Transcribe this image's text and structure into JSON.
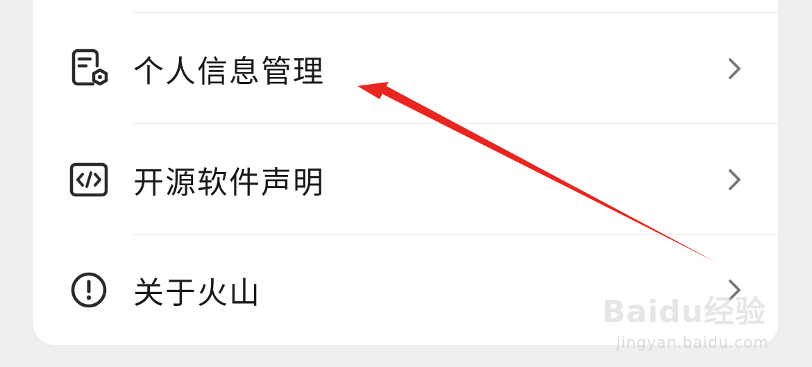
{
  "settings_list": {
    "items": [
      {
        "label": "个人信息管理",
        "icon": "document-settings-icon"
      },
      {
        "label": "开源软件声明",
        "icon": "code-icon"
      },
      {
        "label": "关于火山",
        "icon": "info-exclamation-icon"
      }
    ],
    "chevron_icon": "chevron-right-icon"
  },
  "annotation": {
    "arrow_color": "#e8261f",
    "points_to": "个人信息管理"
  },
  "watermark": {
    "brand": "Baidu经验",
    "url": "jingyan.baidu.com"
  },
  "colors": {
    "background": "#efefef",
    "card": "#ffffff",
    "text": "#1a1a1a",
    "icon": "#2a2a2a",
    "chevron": "#7a7a7a",
    "divider": "#e3e3e3"
  }
}
